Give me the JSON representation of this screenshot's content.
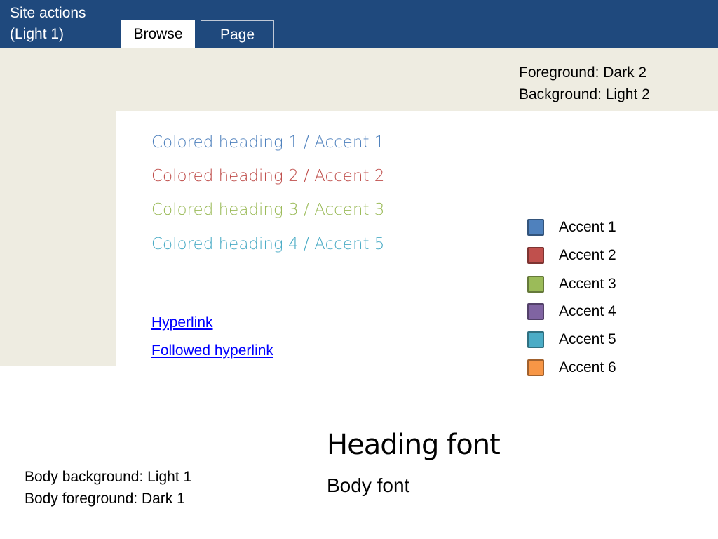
{
  "header": {
    "site_actions_line1": "Site actions",
    "site_actions_line2": "(Light 1)",
    "tabs": [
      {
        "label": "Browse"
      },
      {
        "label": "Page"
      }
    ]
  },
  "ribbon": {
    "line1": "Foreground: Dark 2",
    "line2": "Background: Light 2"
  },
  "headings": [
    {
      "text": "Colored heading 1 / Accent 1",
      "color": "#4f81bd"
    },
    {
      "text": "Colored heading 2 / Accent 2",
      "color": "#c0504d"
    },
    {
      "text": "Colored heading 3 / Accent 3",
      "color": "#9bbb59"
    },
    {
      "text": "Colored heading 4 / Accent 5",
      "color": "#4bacc6"
    }
  ],
  "links": {
    "hyperlink": "Hyperlink",
    "followed": "Followed hyperlink",
    "hyperlink_color": "#0000ff",
    "followed_color": "#0000ff"
  },
  "accents": [
    {
      "label": "Accent 1",
      "color": "#4f81bd"
    },
    {
      "label": "Accent 2",
      "color": "#c0504d"
    },
    {
      "label": "Accent 3",
      "color": "#9bbb59"
    },
    {
      "label": "Accent 4",
      "color": "#8064a2"
    },
    {
      "label": "Accent 5",
      "color": "#4bacc6"
    },
    {
      "label": "Accent 6",
      "color": "#f79646"
    }
  ],
  "fonts": {
    "heading": "Heading font",
    "body": "Body font"
  },
  "body_info": {
    "line1": "Body background: Light 1",
    "line2": "Body foreground: Dark 1"
  },
  "colors": {
    "dark2_bar": "#1f497d",
    "light2": "#eeece1",
    "light1": "#ffffff",
    "dark1": "#000000"
  }
}
